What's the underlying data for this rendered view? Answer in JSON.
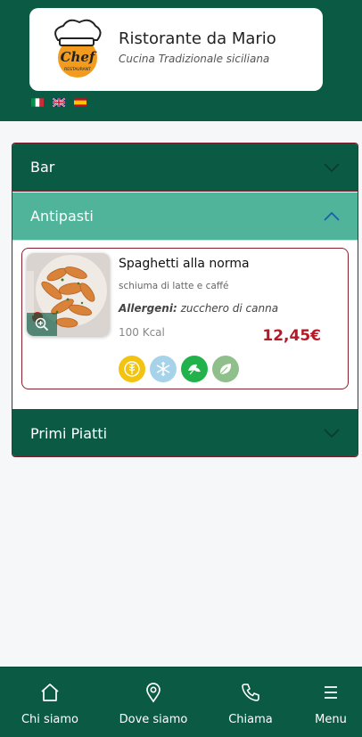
{
  "header": {
    "restaurant_name": "Ristorante da Mario",
    "tagline": "Cucina Tradizionale siciliana",
    "logo_icon": "chef-logo-icon",
    "logo_text": "Chef",
    "logo_subtext": "RESTAURANT",
    "languages": [
      "it",
      "en",
      "es"
    ]
  },
  "menu": {
    "categories": [
      {
        "label": "Bar",
        "expanded": false
      },
      {
        "label": "Antipasti",
        "expanded": true
      },
      {
        "label": "Primi Piatti",
        "expanded": false
      }
    ],
    "dish": {
      "title": "Spaghetti alla norma",
      "description": "schiuma di latte e caffé",
      "allergens_label": "Allergeni:",
      "allergens_value": "zucchero di canna",
      "kcal": "100 Kcal",
      "price": "12,45€",
      "badges": [
        {
          "icon": "gluten-free-icon",
          "color": "#f2c40f"
        },
        {
          "icon": "frozen-snowflake-icon",
          "color": "#a7d3ea"
        },
        {
          "icon": "vegan-leaves-icon",
          "color": "#22b24c"
        },
        {
          "icon": "vegetarian-leaf-icon",
          "color": "#8fbf8a"
        }
      ]
    }
  },
  "bottom_nav": [
    {
      "label": "Chi siamo",
      "icon": "home-icon"
    },
    {
      "label": "Dove siamo",
      "icon": "location-pin-icon"
    },
    {
      "label": "Chiama",
      "icon": "phone-icon"
    },
    {
      "label": "Menu",
      "icon": "hamburger-menu-icon"
    }
  ],
  "colors": {
    "primary": "#0b5a44",
    "accent_light": "#4fb49a",
    "price": "#b51a28",
    "border": "#7a1a2a"
  }
}
